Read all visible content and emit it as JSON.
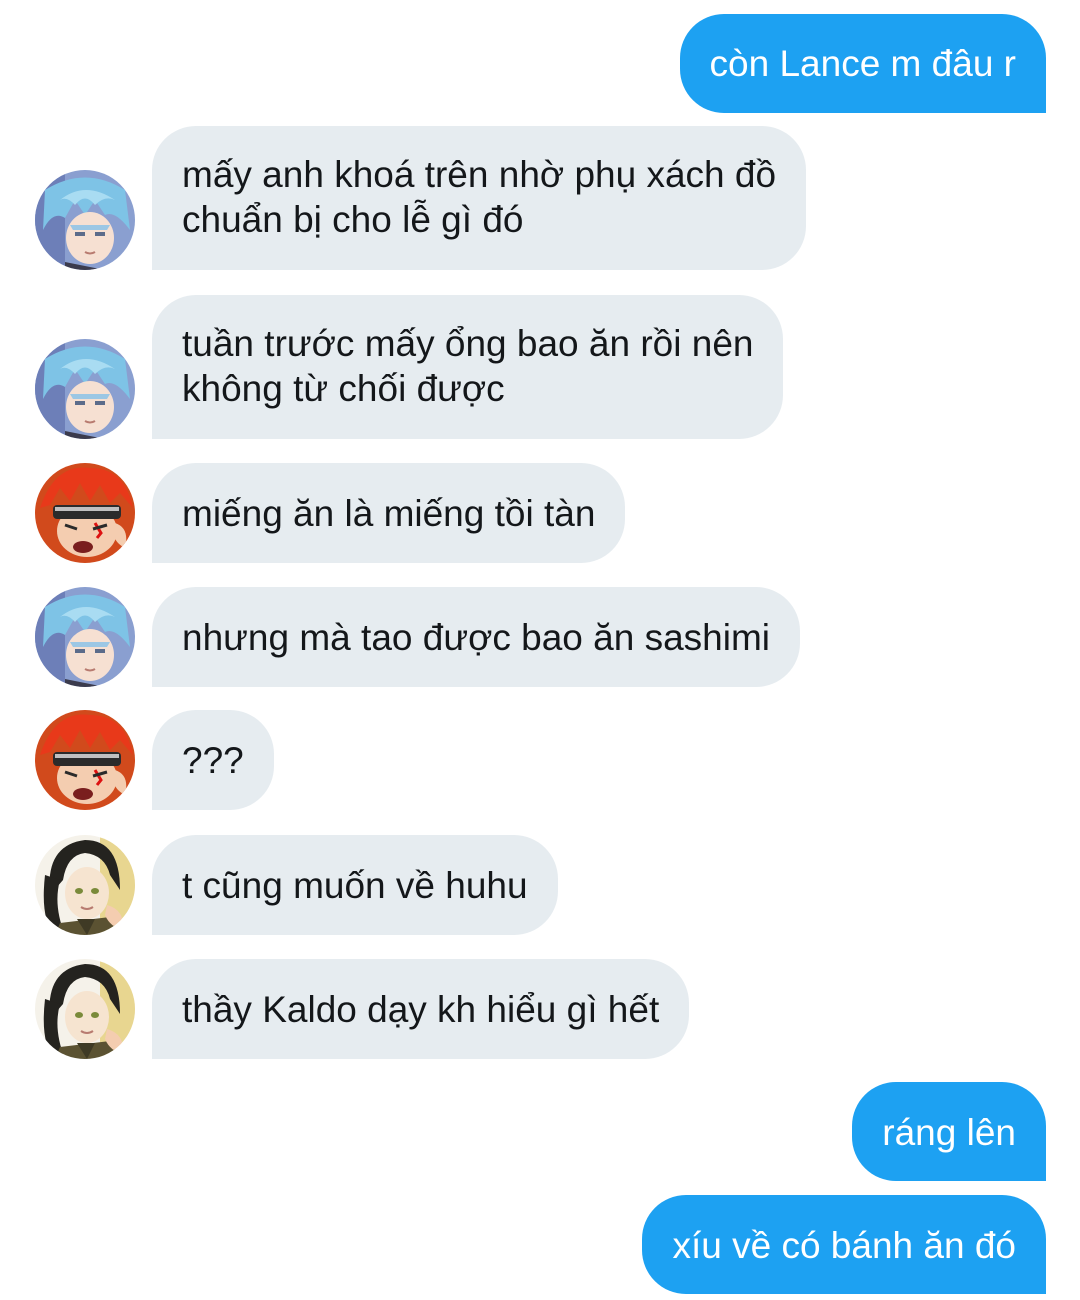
{
  "messages": [
    {
      "id": "m1",
      "direction": "outgoing",
      "text": "còn Lance m đâu r"
    },
    {
      "id": "m2",
      "direction": "incoming",
      "sender_avatar": "blue-hair-avatar",
      "lines": [
        "mấy anh khoá trên nhờ phụ xách đồ",
        "chuẩn bị cho lễ gì đó"
      ]
    },
    {
      "id": "m3",
      "direction": "incoming",
      "sender_avatar": "blue-hair-avatar",
      "lines": [
        "tuần trước mấy ổng bao ăn rồi nên",
        "không từ chối được"
      ]
    },
    {
      "id": "m4",
      "direction": "incoming",
      "sender_avatar": "red-hair-avatar",
      "text": "miếng ăn là miếng tồi tàn"
    },
    {
      "id": "m5",
      "direction": "incoming",
      "sender_avatar": "blue-hair-avatar",
      "text": "nhưng mà tao được bao ăn sashimi"
    },
    {
      "id": "m6",
      "direction": "incoming",
      "sender_avatar": "red-hair-avatar",
      "text": "???"
    },
    {
      "id": "m7",
      "direction": "incoming",
      "sender_avatar": "dark-hair-avatar",
      "text": "t cũng muốn về huhu"
    },
    {
      "id": "m8",
      "direction": "incoming",
      "sender_avatar": "dark-hair-avatar",
      "text": "thầy Kaldo dạy kh hiểu gì hết"
    },
    {
      "id": "m9",
      "direction": "outgoing",
      "text": "ráng lên"
    },
    {
      "id": "m10",
      "direction": "outgoing",
      "text": "xíu về có bánh ăn đó"
    }
  ],
  "colors": {
    "outgoing_bubble": "#1da1f2",
    "incoming_bubble": "#e6ecf0",
    "incoming_text": "#14171a",
    "outgoing_text": "#ffffff"
  }
}
